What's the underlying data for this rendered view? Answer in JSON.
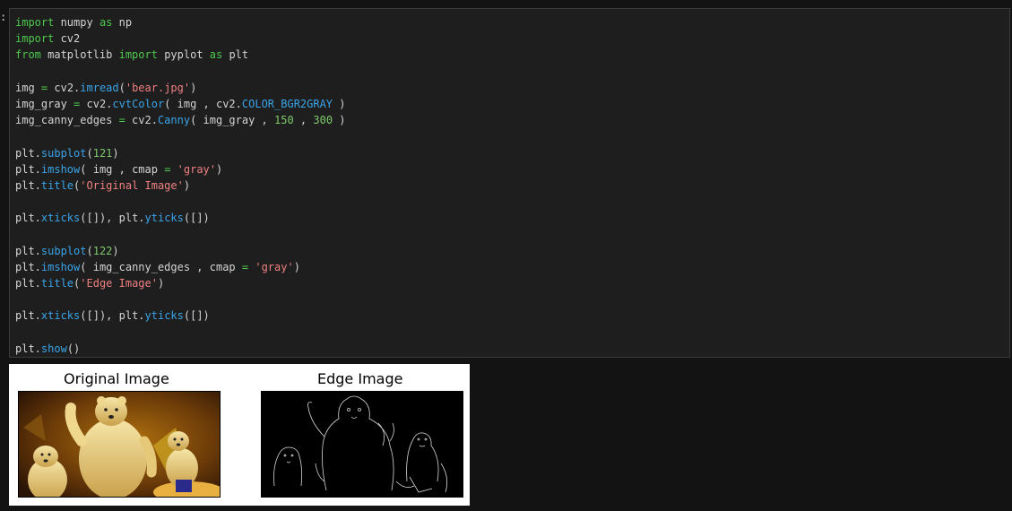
{
  "code_lines": [
    [
      {
        "t": "import",
        "c": "kw"
      },
      {
        "t": " numpy "
      },
      {
        "t": "as",
        "c": "kw"
      },
      {
        "t": " np"
      }
    ],
    [
      {
        "t": "import",
        "c": "kw"
      },
      {
        "t": " cv2"
      }
    ],
    [
      {
        "t": "from",
        "c": "kw"
      },
      {
        "t": " matplotlib "
      },
      {
        "t": "import",
        "c": "kw"
      },
      {
        "t": " pyplot "
      },
      {
        "t": "as",
        "c": "kw"
      },
      {
        "t": " plt"
      }
    ],
    [],
    [
      {
        "t": "img "
      },
      {
        "t": "=",
        "c": "op"
      },
      {
        "t": " cv2."
      },
      {
        "t": "imread",
        "c": "fn"
      },
      {
        "t": "("
      },
      {
        "t": "'bear.jpg'",
        "c": "str"
      },
      {
        "t": ")"
      }
    ],
    [
      {
        "t": "img_gray "
      },
      {
        "t": "=",
        "c": "op"
      },
      {
        "t": " cv2."
      },
      {
        "t": "cvtColor",
        "c": "fn"
      },
      {
        "t": "( img , cv2."
      },
      {
        "t": "COLOR_BGR2GRAY",
        "c": "fn"
      },
      {
        "t": " )"
      }
    ],
    [
      {
        "t": "img_canny_edges "
      },
      {
        "t": "=",
        "c": "op"
      },
      {
        "t": " cv2."
      },
      {
        "t": "Canny",
        "c": "fn"
      },
      {
        "t": "( img_gray , "
      },
      {
        "t": "150",
        "c": "num"
      },
      {
        "t": " , "
      },
      {
        "t": "300",
        "c": "num"
      },
      {
        "t": " )"
      }
    ],
    [],
    [
      {
        "t": "plt."
      },
      {
        "t": "subplot",
        "c": "fn"
      },
      {
        "t": "("
      },
      {
        "t": "121",
        "c": "num"
      },
      {
        "t": ")"
      }
    ],
    [
      {
        "t": "plt."
      },
      {
        "t": "imshow",
        "c": "fn"
      },
      {
        "t": "( img , cmap "
      },
      {
        "t": "=",
        "c": "op"
      },
      {
        "t": " "
      },
      {
        "t": "'gray'",
        "c": "str"
      },
      {
        "t": ")"
      }
    ],
    [
      {
        "t": "plt."
      },
      {
        "t": "title",
        "c": "fn"
      },
      {
        "t": "("
      },
      {
        "t": "'Original Image'",
        "c": "str"
      },
      {
        "t": ")"
      }
    ],
    [],
    [
      {
        "t": "plt."
      },
      {
        "t": "xticks",
        "c": "fn"
      },
      {
        "t": "([]), plt."
      },
      {
        "t": "yticks",
        "c": "fn"
      },
      {
        "t": "([])"
      }
    ],
    [],
    [
      {
        "t": "plt."
      },
      {
        "t": "subplot",
        "c": "fn"
      },
      {
        "t": "("
      },
      {
        "t": "122",
        "c": "num"
      },
      {
        "t": ")"
      }
    ],
    [
      {
        "t": "plt."
      },
      {
        "t": "imshow",
        "c": "fn"
      },
      {
        "t": "( img_canny_edges , cmap "
      },
      {
        "t": "=",
        "c": "op"
      },
      {
        "t": " "
      },
      {
        "t": "'gray'",
        "c": "str"
      },
      {
        "t": ")"
      }
    ],
    [
      {
        "t": "plt."
      },
      {
        "t": "title",
        "c": "fn"
      },
      {
        "t": "("
      },
      {
        "t": "'Edge Image'",
        "c": "str"
      },
      {
        "t": ")"
      }
    ],
    [],
    [
      {
        "t": "plt."
      },
      {
        "t": "xticks",
        "c": "fn"
      },
      {
        "t": "([]), plt."
      },
      {
        "t": "yticks",
        "c": "fn"
      },
      {
        "t": "([])"
      }
    ],
    [],
    [
      {
        "t": "plt."
      },
      {
        "t": "show",
        "c": "fn"
      },
      {
        "t": "()"
      }
    ]
  ],
  "output": {
    "plot1_title": "Original Image",
    "plot2_title": "Edge Image"
  },
  "cell_marker": ":",
  "colors": {
    "keyword": "#4ec94e",
    "string": "#f08080",
    "number": "#7ec96b",
    "function": "#3aa4e8",
    "text": "#d4d4d4",
    "editor_bg": "#1e1e1e"
  }
}
